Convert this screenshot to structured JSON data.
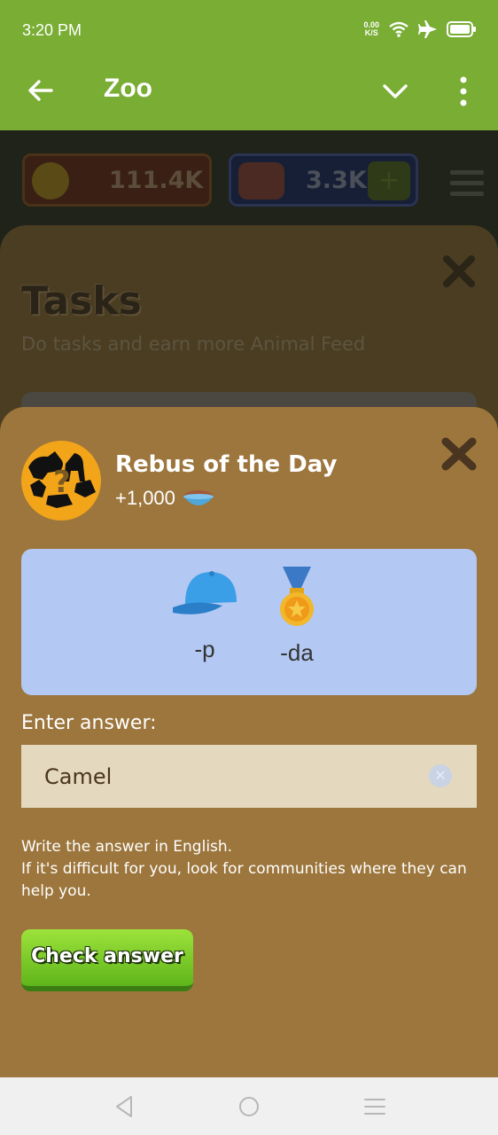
{
  "status_bar": {
    "time": "3:20 PM",
    "net_speed_value": "0.00",
    "net_speed_unit": "K/S",
    "icons": [
      "wifi-icon",
      "airplane-icon",
      "battery-icon"
    ]
  },
  "app_bar": {
    "title": "Zoo",
    "icons": [
      "back-arrow-icon",
      "chevron-down-icon",
      "more-vert-icon"
    ]
  },
  "game_header": {
    "coins": "111.4K",
    "feed": "3.3K",
    "plus_label": "+"
  },
  "tasks_panel": {
    "title": "Tasks",
    "subtitle": "Do tasks and earn more Animal Feed"
  },
  "rebus": {
    "title": "Rebus of the Day",
    "reward": "+1,000",
    "puzzle": [
      {
        "icon": "cap-icon",
        "label": "-p"
      },
      {
        "icon": "medal-icon",
        "label": "-da"
      }
    ],
    "enter_label": "Enter answer:",
    "answer_value": "Camel",
    "hint_line1": "Write the answer in English.",
    "hint_line2": "If it's difficult for you, look for communities where they can help you.",
    "check_button": "Check answer"
  },
  "colors": {
    "app_bar": "#79ad34",
    "sheet": "#9c763c",
    "puzzle_bg": "#b3c8f3",
    "answer_bg": "#e4d9bf",
    "check_button": "#7acb2a"
  }
}
